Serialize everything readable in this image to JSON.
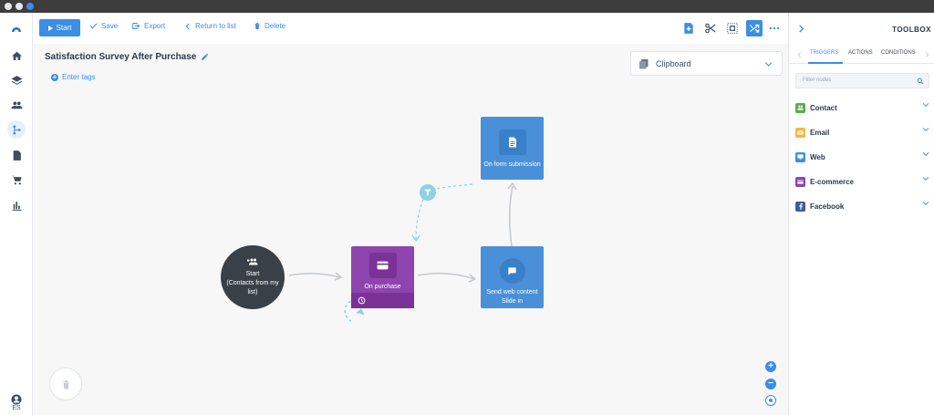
{
  "toolbar": {
    "start_label": "Start",
    "save_label": "Save",
    "export_label": "Export",
    "return_label": "Return to list",
    "delete_label": "Delete"
  },
  "canvas": {
    "title": "Satisfaction Survey After Purchase",
    "tags_label": "Enter tags",
    "clipboard_label": "Clipboard",
    "nodes": {
      "start_label": "Start",
      "start_sub": "(Contacts from my list)",
      "purchase_label": "On purchase",
      "form_label": "On form submission",
      "web_label": "Send web content",
      "web_sub": "Slide in"
    }
  },
  "sidebar": {
    "user_initials": "ES",
    "items": [
      "home-icon",
      "layers-icon",
      "contacts-icon",
      "workflow-icon",
      "document-icon",
      "cart-icon",
      "stats-icon"
    ]
  },
  "toolbox": {
    "title": "TOOLBOX",
    "tabs": [
      "TRIGGERS",
      "ACTIONS",
      "CONDITIONS"
    ],
    "active_tab": "TRIGGERS",
    "filter_placeholder": "Filter nodes",
    "categories": [
      {
        "label": "Contact",
        "color": "#5cab4e"
      },
      {
        "label": "Email",
        "color": "#f4b942"
      },
      {
        "label": "Web",
        "color": "#3a8ee6"
      },
      {
        "label": "E-commerce",
        "color": "#8e44ad"
      },
      {
        "label": "Facebook",
        "color": "#3b5ba5"
      }
    ]
  },
  "colors": {
    "accent": "#3a8ee6",
    "purchase_node": "#8e44ad",
    "web_node": "#4a90d9",
    "start_node": "#3a4047"
  }
}
